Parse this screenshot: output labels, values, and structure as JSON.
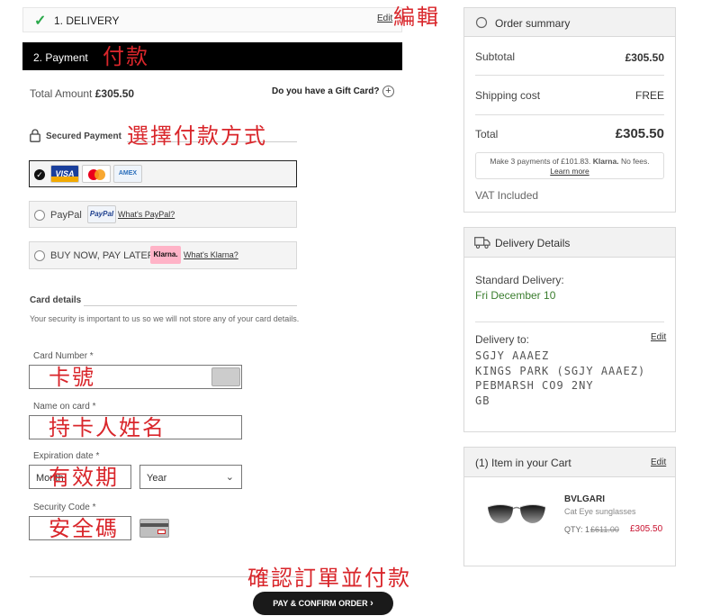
{
  "delivery_step": {
    "check_icon": "checkmark-icon",
    "title": "1. DELIVERY",
    "edit_label": "Edit",
    "annotation": "編輯"
  },
  "payment_step": {
    "title": "2. Payment",
    "annotation": "付款"
  },
  "totals": {
    "label": "Total Amount",
    "amount": "£305.50"
  },
  "gift_card": {
    "label": "Do you have a Gift Card?",
    "icon": "plus-circle-icon"
  },
  "secured": {
    "label": "Secured Payment",
    "icon": "lock-icon",
    "annotation": "選擇付款方式"
  },
  "payment_methods": {
    "cards": {
      "selected": true,
      "logos": [
        "VISA",
        "MasterCard",
        "AMEX"
      ]
    },
    "paypal": {
      "label": "PayPal",
      "logo": "PayPal",
      "link": "What's PayPal?"
    },
    "klarna": {
      "label": "BUY NOW, PAY LATER",
      "logo": "Klarna.",
      "link": "What's Klarna?"
    }
  },
  "card_details": {
    "title": "Card details",
    "note": "Your security is important to us so we will not store any of your card details.",
    "card_number_label": "Card Number *",
    "card_number_annotation": "卡號",
    "name_label": "Name on card *",
    "name_annotation": "持卡人姓名",
    "expiration_label": "Expiration date *",
    "month_placeholder": "Month",
    "year_placeholder": "Year",
    "expiration_annotation": "有效期",
    "security_label": "Security Code *",
    "security_annotation": "安全碼"
  },
  "confirm": {
    "annotation": "確認訂單並付款",
    "button_label": "PAY & CONFIRM ORDER",
    "button_icon": "chevron-right-icon"
  },
  "order_summary": {
    "title": "Order summary",
    "icon": "circle-icon",
    "subtotal_label": "Subtotal",
    "subtotal_value": "£305.50",
    "shipping_label": "Shipping cost",
    "shipping_value": "FREE",
    "total_label": "Total",
    "total_value": "£305.50",
    "klarna_text_a": "Make 3 payments of £101.83.",
    "klarna_brand": "Klarna.",
    "klarna_text_b": "No fees.",
    "klarna_link": "Learn more",
    "vat": "VAT Included"
  },
  "delivery_details": {
    "title": "Delivery Details",
    "icon": "truck-icon",
    "method_label": "Standard Delivery:",
    "date": "Fri December 10",
    "delivery_to_label": "Delivery to:",
    "edit_label": "Edit",
    "address": [
      "SGJY AAAEZ",
      "KINGS PARK (SGJY AAAEZ)",
      "PEBMARSH CO9 2NY",
      "GB"
    ]
  },
  "cart": {
    "title": "(1)  Item in your Cart",
    "edit_label": "Edit",
    "item": {
      "brand": "BVLGARI",
      "name": "Cat Eye sunglasses",
      "qty_label": "QTY: 1",
      "old_price": "£611.00",
      "price": "£305.50"
    }
  }
}
